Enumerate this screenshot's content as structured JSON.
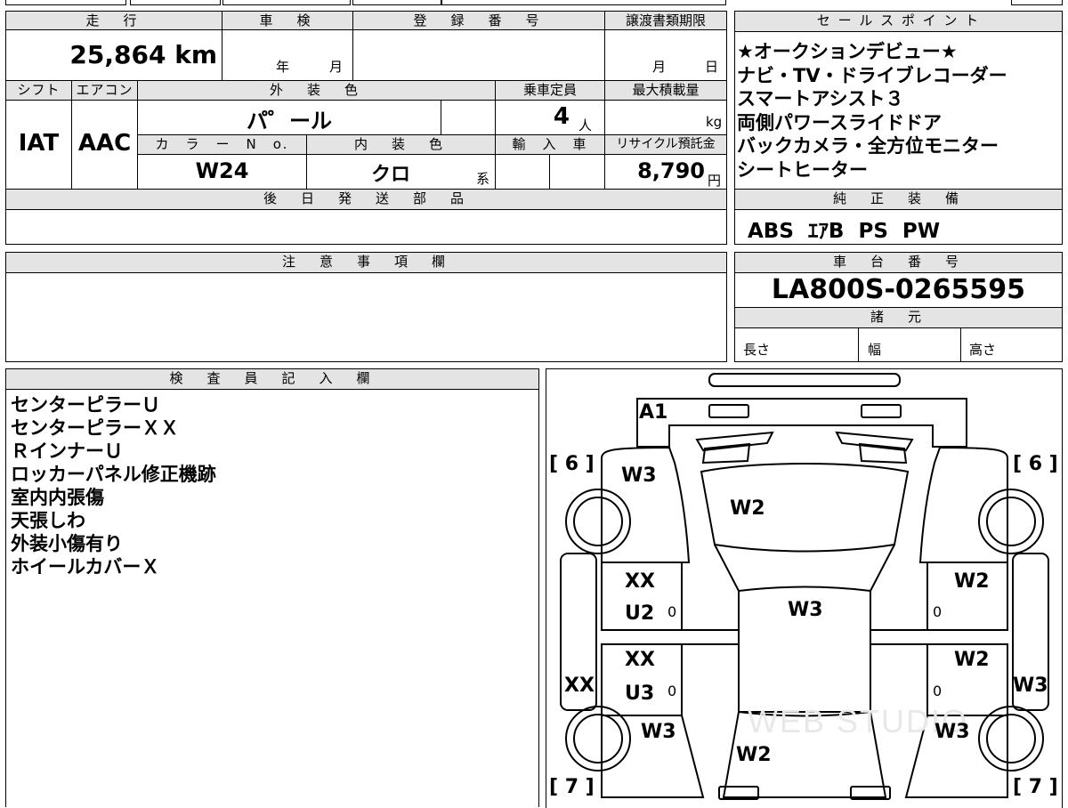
{
  "top": {
    "mileage_hdr": "走　行",
    "mileage": "25,864 km",
    "shaken_hdr": "車　検",
    "shaken_year": "年",
    "shaken_month": "月",
    "reg_hdr": "登　録　番　号",
    "transfer_hdr": "譲渡書類期限",
    "transfer_month": "月",
    "transfer_day": "日"
  },
  "row2": {
    "shift_hdr": "シフト",
    "shift": "IAT",
    "ac_hdr": "エアコン",
    "ac": "AAC",
    "exterior_hdr": "外　装　色",
    "exterior": "パ゜ール",
    "capacity_hdr": "乗車定員",
    "capacity": "4",
    "capacity_unit": "人",
    "load_hdr": "最大積載量",
    "load_unit": "kg",
    "colorno_hdr": "カ　ラ　ー　N　o.",
    "colorno": "W24",
    "interior_hdr": "内　装　色",
    "interior": "クロ",
    "interior_unit": "系",
    "import_hdr": "輸　入　車",
    "recycle_hdr": "リサイクル預託金",
    "recycle": "8,790",
    "recycle_unit": "円"
  },
  "later_parts_hdr": "後　日　発　送　部　品",
  "caution_hdr": "注　意　事　項　欄",
  "sales": {
    "hdr": "セ ー ル ス ポ イ ン ト",
    "lines": [
      "★オークションデビュー★",
      "ナビ・TV・ドライブレコーダー",
      "スマートアシスト３",
      "両側パワースライドドア",
      "バックカメラ・全方位モニター",
      "シートヒーター"
    ]
  },
  "equipment": {
    "hdr": "純　正　装　備",
    "value": "ABS  ｴｱB  PS  PW"
  },
  "chassis": {
    "hdr": "車　台　番　号",
    "value": "LA800S-0265595"
  },
  "specs": {
    "hdr": "諸　元",
    "length": "長さ",
    "width": "幅",
    "height": "高さ"
  },
  "inspector": {
    "hdr": "検　査　員　記　入　欄",
    "lines": [
      "センターピラーＵ",
      "センターピラーＸＸ",
      "ＲインナーＵ",
      "ロッカーパネル修正機跡",
      "室内内張傷",
      "天張しわ",
      "外装小傷有り",
      "ホイールカバーＸ"
    ]
  },
  "diagram": {
    "labels": {
      "a1": "A1",
      "w3_front_left": "W3",
      "w2_hood": "W2",
      "xx_front_left_door": "XX",
      "u2_front_left_door": "U2",
      "zero_fl": "0",
      "w3_roof": "W3",
      "w2_front_right_door": "W2",
      "zero_fr": "0",
      "xx_rear_left_door": "XX",
      "u3_rear_left_door": "U3",
      "zero_rl": "0",
      "w2_rear_right_door": "W2",
      "zero_rr": "0",
      "xx_left_rocker": "XX",
      "w3_right_rocker": "W3",
      "w3_rear_left": "W3",
      "w3_rear_right": "W3",
      "w2_rear": "W2",
      "bracket_fl": "[ 6 ]",
      "bracket_fr": "[ 6 ]",
      "bracket_rl": "[ 7 ]",
      "bracket_rr": "[ 7 ]"
    }
  }
}
